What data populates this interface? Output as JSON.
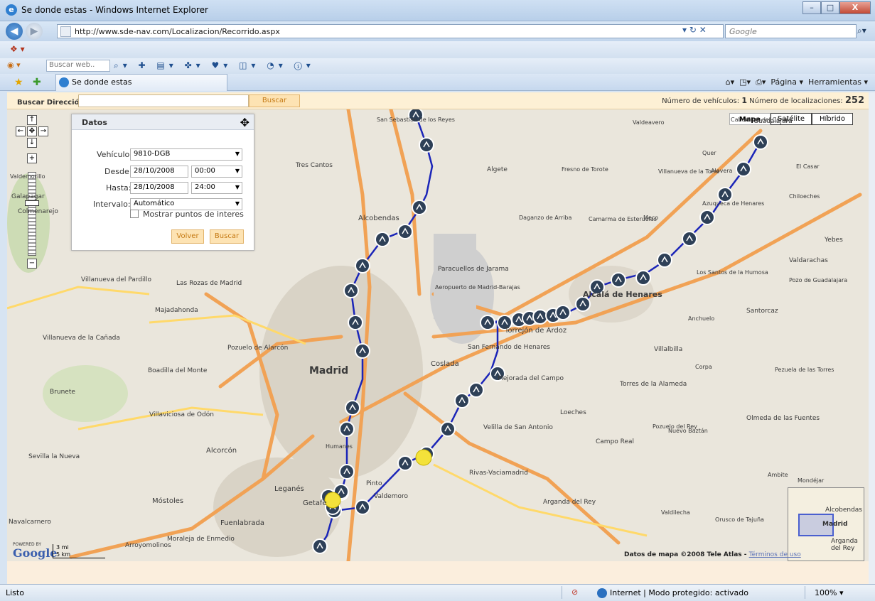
{
  "window": {
    "title": "Se donde estas - Windows Internet Explorer",
    "min": "–",
    "max": "□",
    "close": "X"
  },
  "address": {
    "url": "http://www.sde-nav.com/Localizacion/Recorrido.aspx",
    "search_placeholder": "Google"
  },
  "toolbar": {
    "search_placeholder": "Buscar web..",
    "page_menu": "Página ▾",
    "tools_menu": "Herramientas ▾"
  },
  "tab": {
    "label": "Se donde estas"
  },
  "header": {
    "search_label": "Buscar Dirección:",
    "search_button": "Buscar",
    "vehicles_label": "Número de vehículos:",
    "vehicles_count": "1",
    "locations_label": "Número de localizaciones:",
    "locations_count": "252"
  },
  "map": {
    "types": [
      "Mapa",
      "Satélite",
      "Híbrido"
    ],
    "copyright": "Datos de mapa ©2008 Tele Atlas -",
    "terms": "Términos de uso",
    "scale_mi": "3 mi",
    "scale_km": "5 km",
    "google": "Google",
    "powered": "POWERED BY",
    "labels": [
      "Madrid",
      "Alcobendas",
      "Tres Cantos",
      "Coslada",
      "San Fernando de Henares",
      "Torrejón de Ardoz",
      "Alcalá de Henares",
      "Getafe",
      "Leganés",
      "Alcorcón",
      "Móstoles",
      "Fuenlabrada",
      "Pozuelo de Alarcón",
      "Majadahonda",
      "Las Rozas de Madrid",
      "Boadilla del Monte",
      "Villaviciosa de Odón",
      "Rivas-Vaciamadrid",
      "Arganda del Rey",
      "Mejorada del Campo",
      "Velilla de San Antonio",
      "Paracuellos de Jarama",
      "Aeropuerto de Madrid-Barajas",
      "Guadalajara",
      "Azuqueca de Henares",
      "Alovera",
      "Meco",
      "Daganzo de Arriba",
      "Camarma de Esteruelas",
      "Villalbilla",
      "Torres de la Alameda",
      "Loeches",
      "Pinto",
      "Valdemoro",
      "Campo Real",
      "Nuevo Baztán",
      "Pozuelo del Rey",
      "Villanueva de la Cañada",
      "Villanueva del Pardillo",
      "Brunete",
      "Sevilla la Nueva",
      "Navalcarnero",
      "Moraleja de Enmedio",
      "Arroyomolinos",
      "Humanes",
      "Colmenarejo",
      "Galapagar",
      "Valdemorillo",
      "San Sebastián de los Reyes",
      "Algete",
      "Fresno de Torote",
      "Valdeavero",
      "Santorcaz",
      "Anchuelo",
      "Corpa",
      "Pezuela de las Torres",
      "Olmeda de las Fuentes",
      "Valdilecha",
      "Orusco de Tajuña",
      "Ambite",
      "Mondéjar",
      "Yebes",
      "Valdarachas",
      "Pozo de Guadalajara",
      "Chiloeches",
      "El Casar",
      "Cabanillas del Campo",
      "Quer",
      "Villanueva de la Torre",
      "Los Santos de la Humosa"
    ],
    "overview_labels": [
      "Alcobendas",
      "Madrid",
      "Arganda del Rey"
    ]
  },
  "datos": {
    "title": "Datos",
    "vehicle_label": "Vehículo:",
    "vehicle_value": "9810-DGB",
    "from_label": "Desde:",
    "from_date": "28/10/2008",
    "from_time": "00:00",
    "to_label": "Hasta:",
    "to_date": "28/10/2008",
    "to_time": "24:00",
    "interval_label": "Intervalo:",
    "interval_value": "Automático",
    "poi_label": "Mostrar puntos de interes",
    "back_button": "Volver",
    "search_button": "Buscar"
  },
  "status": {
    "text": "Listo",
    "zone": "Internet | Modo protegido: activado",
    "zoom": "100% ▾"
  }
}
